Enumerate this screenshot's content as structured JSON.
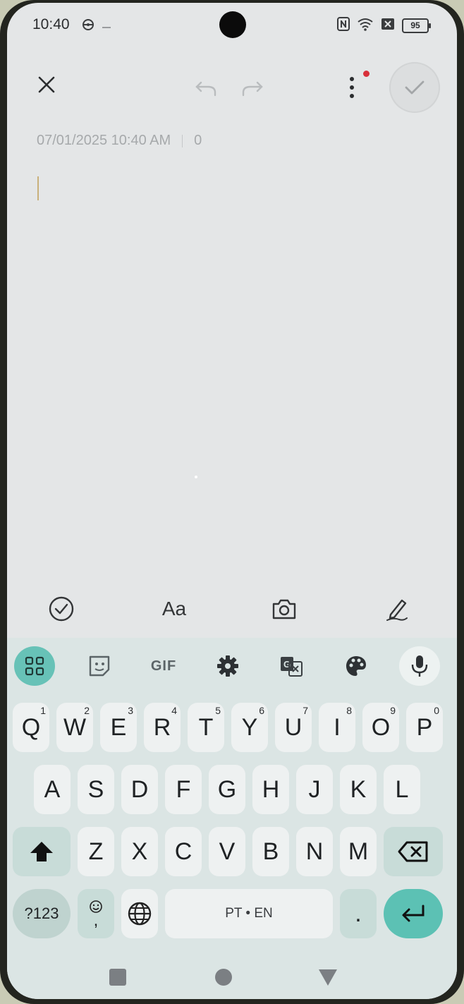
{
  "status_bar": {
    "time": "10:40",
    "battery": "95",
    "icons": [
      "steering-icon",
      "dash-icon",
      "nfc-icon",
      "wifi-icon",
      "sim-icon"
    ]
  },
  "top_bar": {
    "close_icon": "close-icon",
    "undo_icon": "undo-icon",
    "redo_icon": "redo-icon",
    "more_icon": "more-vertical-icon",
    "save_icon": "check-icon"
  },
  "note": {
    "datetime": "07/01/2025 10:40 AM",
    "char_count": "0",
    "body": ""
  },
  "note_toolbar": {
    "format_label": "Aa",
    "items": [
      "checklist-icon",
      "text-format-icon",
      "camera-icon",
      "pen-icon"
    ]
  },
  "keyboard": {
    "suggestion_bar": {
      "gif_label": "GIF",
      "items": [
        "apps-grid-icon",
        "sticker-icon",
        "gif",
        "settings-icon",
        "translate-icon",
        "palette-icon",
        "mic-icon"
      ]
    },
    "row1": [
      {
        "k": "Q",
        "n": "1"
      },
      {
        "k": "W",
        "n": "2"
      },
      {
        "k": "E",
        "n": "3"
      },
      {
        "k": "R",
        "n": "4"
      },
      {
        "k": "T",
        "n": "5"
      },
      {
        "k": "Y",
        "n": "6"
      },
      {
        "k": "U",
        "n": "7"
      },
      {
        "k": "I",
        "n": "8"
      },
      {
        "k": "O",
        "n": "9"
      },
      {
        "k": "P",
        "n": "0"
      }
    ],
    "row2": [
      "A",
      "S",
      "D",
      "F",
      "G",
      "H",
      "J",
      "K",
      "L"
    ],
    "row3": [
      "Z",
      "X",
      "C",
      "V",
      "B",
      "N",
      "M"
    ],
    "symbols_label": "?123",
    "comma_label": ",",
    "space_label": "PT • EN",
    "period_label": "."
  },
  "nav_bar": {
    "items": [
      "recents-square-icon",
      "home-circle-icon",
      "back-triangle-icon"
    ]
  }
}
